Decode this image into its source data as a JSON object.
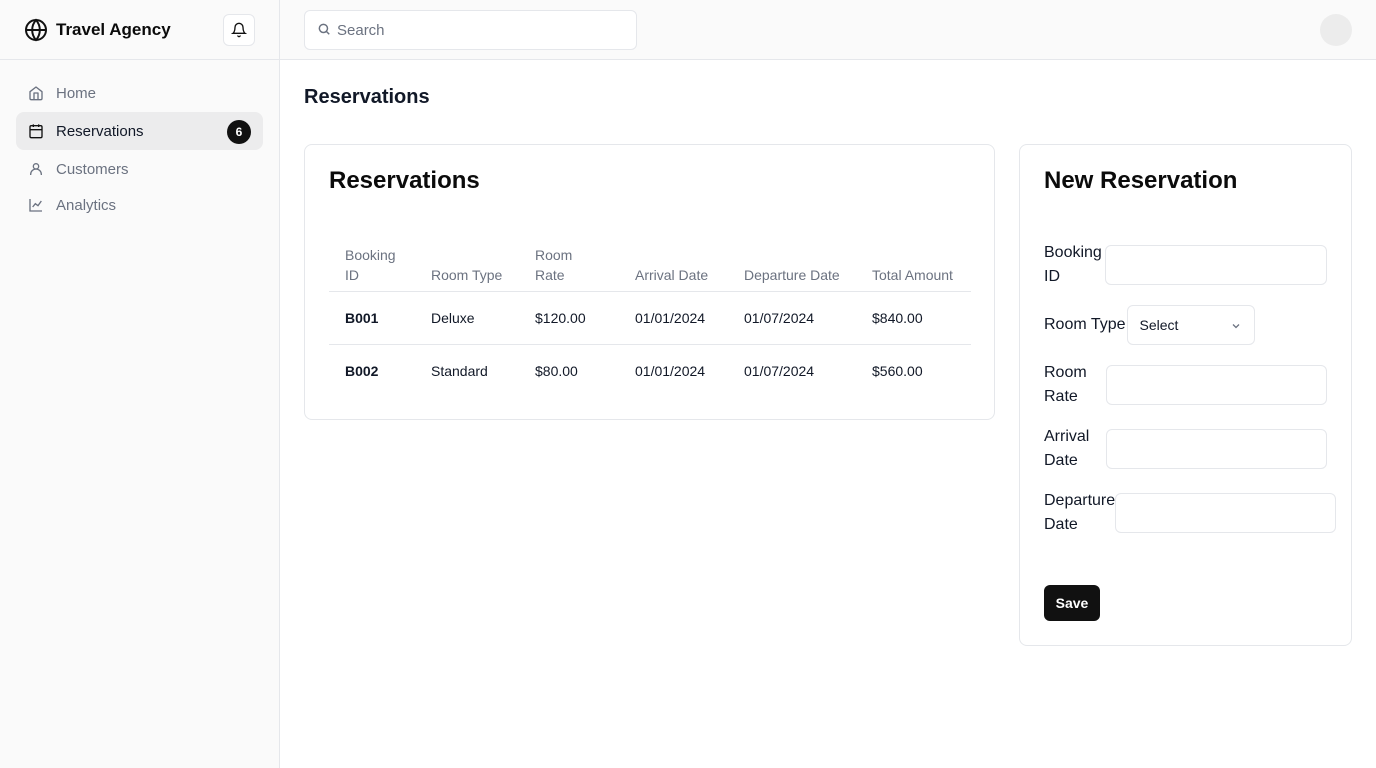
{
  "brand": {
    "name": "Travel Agency",
    "logo_icon": "globe-icon"
  },
  "notifications": {
    "icon": "bell-icon"
  },
  "search": {
    "placeholder": "Search",
    "value": ""
  },
  "sidebar": {
    "items": [
      {
        "label": "Home",
        "icon": "home-icon",
        "active": false
      },
      {
        "label": "Reservations",
        "icon": "calendar-icon",
        "active": true,
        "badge": "6"
      },
      {
        "label": "Customers",
        "icon": "user-icon",
        "active": false
      },
      {
        "label": "Analytics",
        "icon": "line-chart-icon",
        "active": false
      }
    ]
  },
  "page": {
    "title": "Reservations"
  },
  "reservations_table": {
    "title": "Reservations",
    "columns": [
      "Booking ID",
      "Room Type",
      "Room Rate",
      "Arrival Date",
      "Departure Date",
      "Total Amount"
    ],
    "rows": [
      [
        "B001",
        "Deluxe",
        "$120.00",
        "01/01/2024",
        "01/07/2024",
        "$840.00"
      ],
      [
        "B002",
        "Standard",
        "$80.00",
        "01/01/2024",
        "01/07/2024",
        "$560.00"
      ]
    ]
  },
  "form": {
    "title": "New Reservation",
    "booking_id_label": "Booking ID",
    "room_type_label": "Room Type",
    "room_type_value": "Select",
    "room_rate_label": "Room Rate",
    "arrival_date_label": "Arrival Date",
    "departure_date_label": "Departure Date",
    "save_label": "Save"
  },
  "colors": {
    "accent": "#111111",
    "border": "#e5e7eb",
    "muted_text": "#6b7280",
    "sidebar_bg": "#fafafa"
  }
}
